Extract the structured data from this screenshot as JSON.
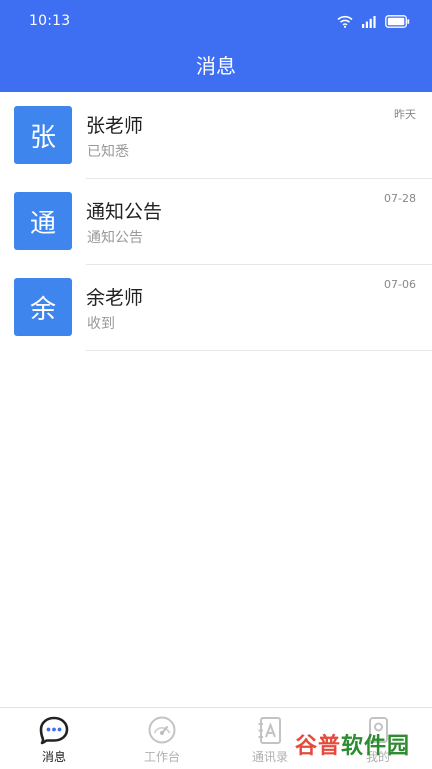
{
  "status_bar": {
    "time": "10:13"
  },
  "header": {
    "title": "消息"
  },
  "messages": [
    {
      "avatar": "张",
      "name": "张老师",
      "preview": "已知悉",
      "time": "昨天"
    },
    {
      "avatar": "通",
      "name": "通知公告",
      "preview": "通知公告",
      "time": "07-28"
    },
    {
      "avatar": "余",
      "name": "余老师",
      "preview": "收到",
      "time": "07-06"
    }
  ],
  "tabs": [
    {
      "label": "消息",
      "icon": "chat-bubble-icon",
      "active": true
    },
    {
      "label": "工作台",
      "icon": "dashboard-gauge-icon",
      "active": false
    },
    {
      "label": "通讯录",
      "icon": "contacts-book-icon",
      "active": false
    },
    {
      "label": "我的",
      "icon": "profile-icon",
      "active": false
    }
  ],
  "watermark": {
    "part1": "谷普",
    "part2": "软件园"
  },
  "colors": {
    "primary": "#3E6EF2",
    "avatar": "#3E86EE",
    "divider": "#E6E6E6",
    "inactive": "#AFAFAF"
  }
}
